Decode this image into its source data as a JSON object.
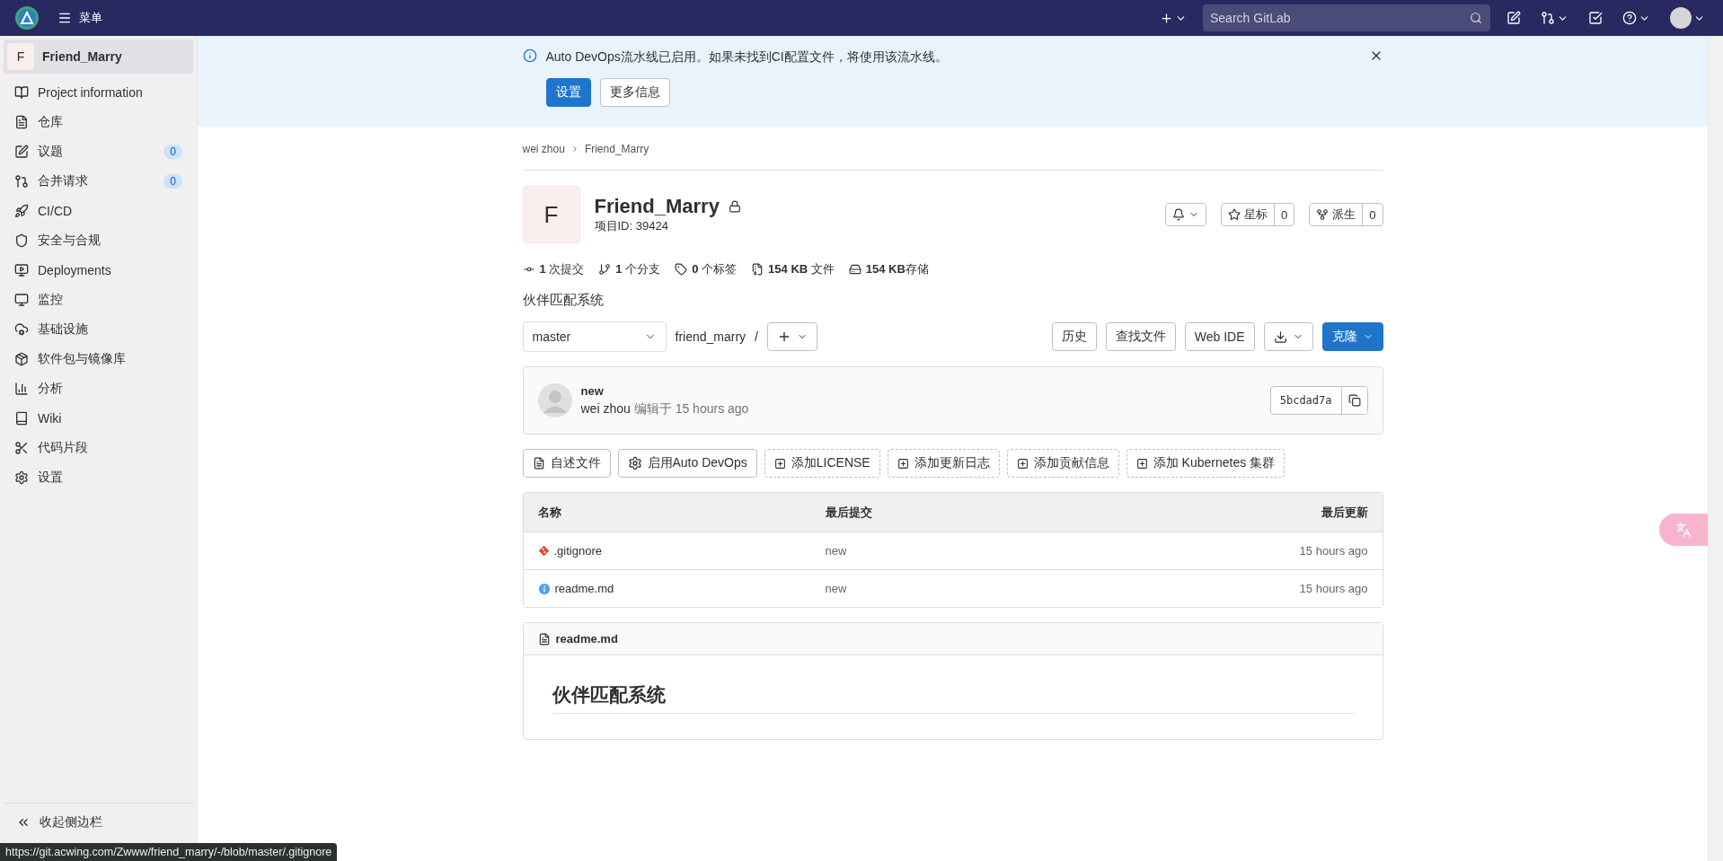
{
  "topbar": {
    "menu_label": "菜单",
    "search_placeholder": "Search GitLab"
  },
  "sidebar": {
    "project": {
      "avatar_letter": "F",
      "name": "Friend_Marry",
      "selected": true
    },
    "items": [
      {
        "label": "Project information",
        "selected": false
      },
      {
        "label": "仓库",
        "selected": false
      },
      {
        "label": "议题",
        "count": "0",
        "selected": false
      },
      {
        "label": "合并请求",
        "count": "0",
        "selected": false
      },
      {
        "label": "CI/CD",
        "selected": false
      },
      {
        "label": "安全与合规",
        "selected": false
      },
      {
        "label": "Deployments",
        "selected": false
      },
      {
        "label": "监控",
        "selected": false
      },
      {
        "label": "基础设施",
        "selected": false
      },
      {
        "label": "软件包与镜像库",
        "selected": false
      },
      {
        "label": "分析",
        "selected": false
      },
      {
        "label": "Wiki",
        "selected": false
      },
      {
        "label": "代码片段",
        "selected": false
      },
      {
        "label": "设置",
        "selected": false
      }
    ],
    "collapse_label": "收起侧边栏"
  },
  "banner": {
    "message": "Auto DevOps流水线已启用。如果未找到CI配置文件，将使用该流水线。",
    "buttons": [
      {
        "label": "设置",
        "kind": "primary"
      },
      {
        "label": "更多信息",
        "kind": "default"
      }
    ]
  },
  "breadcrumb": [
    "wei zhou",
    "Friend_Marry"
  ],
  "project": {
    "avatar_letter": "F",
    "name": "Friend_Marry",
    "id_label": "项目ID: 39424",
    "star_label": "星标",
    "star_count": "0",
    "fork_label": "派生",
    "fork_count": "0"
  },
  "stats": [
    "**1** 次提交",
    "**1** 个分支",
    "**0** 个标签",
    "**154 KB** 文件",
    "**154 KB**存储"
  ],
  "description": "伙伴匹配系统",
  "branch": {
    "name": "master",
    "path": "friend_marry",
    "separator": "/"
  },
  "actions": [
    "历史",
    "查找文件",
    "Web IDE"
  ],
  "clone_label": "克隆",
  "commit": {
    "title": "new",
    "author": "wei zhou",
    "meta": "编辑于 15 hours ago",
    "sha": "5bcdad7a"
  },
  "quick_actions": [
    {
      "label": "自述文件",
      "kind": "file"
    },
    {
      "label": "启用Auto DevOps",
      "kind": "settings"
    },
    {
      "label": "添加LICENSE",
      "kind": "add"
    },
    {
      "label": "添加更新日志",
      "kind": "add"
    },
    {
      "label": "添加贡献信息",
      "kind": "add"
    },
    {
      "label": "添加 Kubernetes 集群",
      "kind": "add"
    }
  ],
  "files": {
    "columns": [
      "名称",
      "最后提交",
      "最后更新"
    ],
    "rows": [
      {
        "name": ".gitignore",
        "kind": "git",
        "commit": "new",
        "updated": "15 hours ago"
      },
      {
        "name": "readme.md",
        "kind": "info",
        "commit": "new",
        "updated": "15 hours ago"
      }
    ]
  },
  "readme": {
    "filename": "readme.md",
    "heading": "伙伴匹配系统"
  },
  "status_url": "https://git.acwing.com/Zwww/friend_marry/-/blob/master/.gitignore"
}
